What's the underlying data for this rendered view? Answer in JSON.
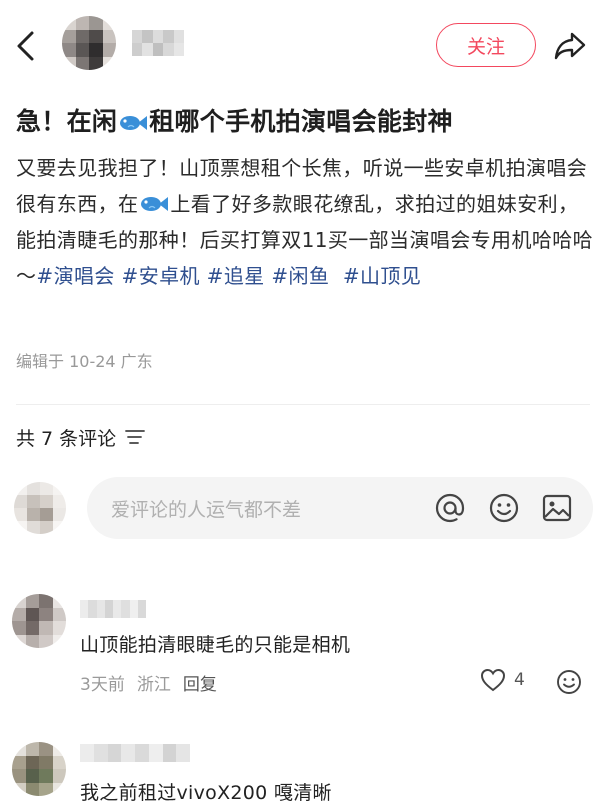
{
  "header": {
    "follow_label": "关注"
  },
  "post": {
    "title_part1": "急！在闲",
    "title_part2": "租哪个手机拍演唱会能封神",
    "body_part1": "又要去见我担了！山顶票想租个长焦，听说一些安卓机拍演唱会很有东西，在",
    "body_part2": "上看了好多款眼花缭乱，求拍过的姐妹安利，能拍清睫毛的那种！后买打算双11买一部当演唱会专用机哈哈哈～",
    "tags": [
      "#演唱会",
      "#安卓机",
      "#追星",
      "#闲鱼",
      "#山顶见"
    ],
    "meta": "编辑于 10-24 广东"
  },
  "comments_section": {
    "heading": "共 7 条评论",
    "input_placeholder": "爱评论的人运气都不差"
  },
  "comments": [
    {
      "text": "山顶能拍清眼睫毛的只能是相机",
      "time": "3天前",
      "location": "浙江",
      "reply_label": "回复",
      "likes": "4"
    },
    {
      "text": "我之前租过vivoX200 嘎清晰"
    }
  ],
  "colors": {
    "accent": "#f3485e",
    "tag": "#2f4f8f",
    "meta": "#999999"
  }
}
